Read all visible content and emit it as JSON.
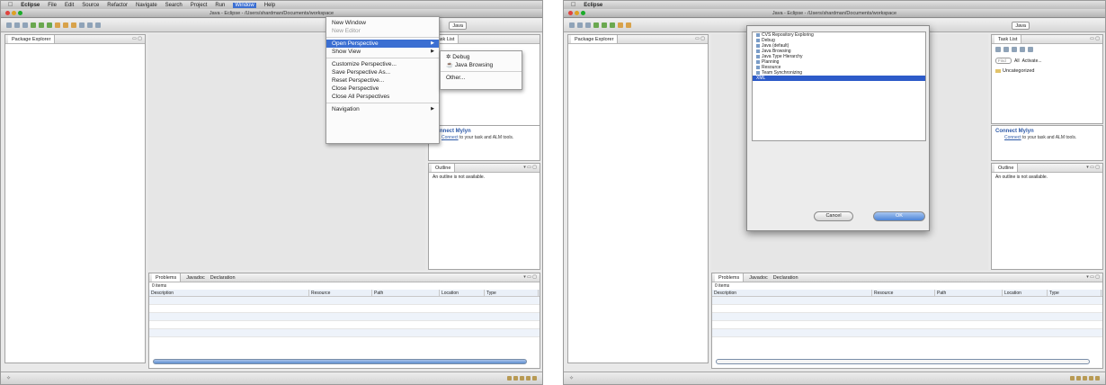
{
  "menubar": {
    "apple": "",
    "app": "Eclipse",
    "items": [
      "File",
      "Edit",
      "Source",
      "Refactor",
      "Navigate",
      "Search",
      "Project",
      "Run",
      "Window",
      "Help"
    ]
  },
  "window_title": "Java - Eclipse - /Users/shardman/Documents/workspace",
  "perspective_label": "Java",
  "package_explorer_tab": "Package Explorer",
  "task_list_tab": "Task List",
  "find_placeholder": "Find",
  "task_filters": {
    "all": "All",
    "activate": "Activate..."
  },
  "uncategorized": "Uncategorized",
  "mylyn": {
    "title": "Connect Mylyn",
    "link": "Connect",
    "text": "to your task and ALM tools."
  },
  "outline": {
    "tab": "Outline",
    "message": "An outline is not available."
  },
  "bottom_tabs": {
    "problems": "Problems",
    "javadoc": "Javadoc",
    "declaration": "Declaration"
  },
  "problems_count": "0 items",
  "problems_columns": [
    "Description",
    "Resource",
    "Path",
    "Location",
    "Type"
  ],
  "window_menu": {
    "new_window": "New Window",
    "new_editor": "New Editor",
    "open_perspective": "Open Perspective",
    "show_view": "Show View",
    "customize": "Customize Perspective...",
    "save_as": "Save Perspective As...",
    "reset": "Reset Perspective...",
    "close": "Close Perspective",
    "close_all": "Close All Perspectives",
    "navigation": "Navigation"
  },
  "perspective_submenu": {
    "debug": "Debug",
    "java_browsing": "Java Browsing",
    "other": "Other..."
  },
  "dialog": {
    "items": [
      "CVS Repository Exploring",
      "Debug",
      "Java (default)",
      "Java Browsing",
      "Java Type Hierarchy",
      "Planning",
      "Resource",
      "Team Synchronizing",
      "XML"
    ],
    "selected_index": 8,
    "cancel": "Cancel",
    "ok": "OK"
  },
  "status_left": "✧"
}
